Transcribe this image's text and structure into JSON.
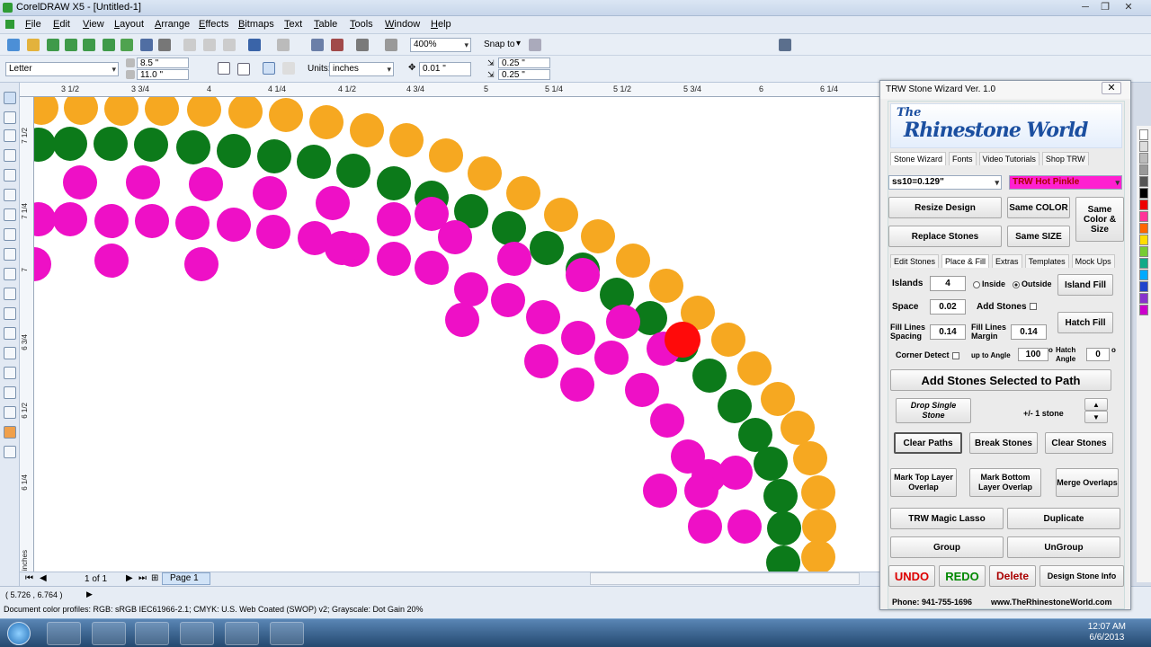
{
  "window": {
    "title": "CorelDRAW X5 - [Untitled-1]"
  },
  "menu": [
    "File",
    "Edit",
    "View",
    "Layout",
    "Arrange",
    "Effects",
    "Bitmaps",
    "Text",
    "Table",
    "Tools",
    "Window",
    "Help"
  ],
  "toolbar": {
    "zoom": "400%",
    "snap_to": "Snap to"
  },
  "property_bar": {
    "paper": "Letter",
    "width": "8.5 \"",
    "height": "11.0 \"",
    "units_label": "Units:",
    "units": "inches",
    "nudge": "0.01 \"",
    "dup_x": "0.25 \"",
    "dup_y": "0.25 \""
  },
  "ruler": {
    "h_ticks": [
      "3 1/2",
      "3 3/4",
      "4",
      "4 1/4",
      "4 1/2",
      "4 3/4",
      "5",
      "5 1/4",
      "5 1/2",
      "5 3/4",
      "6",
      "6 1/4"
    ],
    "v_ticks": [
      "7 1/2",
      "7 1/4",
      "7",
      "6 3/4",
      "6 1/2",
      "6 1/4"
    ],
    "unit": "inches"
  },
  "page_nav": {
    "count": "1 of 1",
    "tab": "Page 1"
  },
  "status": {
    "coords": "( 5.726 , 6.764 )",
    "profiles": "Document color profiles: RGB: sRGB IEC61966-2.1; CMYK: U.S. Web Coated (SWOP) v2; Grayscale: Dot Gain 20%"
  },
  "colors": {
    "orange": "#f6a821",
    "green": "#0c7a1a",
    "magenta": "#ee10c6",
    "red": "#ff0a0a",
    "hot_pink": "#ff20d0"
  },
  "wizard": {
    "title": "TRW Stone Wizard Ver. 1.0",
    "logo_top": "The",
    "logo": "Rhinestone World",
    "tabs": [
      "Stone Wizard",
      "Fonts",
      "Video Tutorials",
      "Shop TRW"
    ],
    "stone_size": "ss10=0.129\"",
    "color_name": "TRW Hot Pinkle",
    "buttons": {
      "resize": "Resize Design",
      "same_color": "Same COLOR",
      "same_color_size": "Same Color & Size",
      "replace": "Replace Stones",
      "same_size": "Same SIZE",
      "island_fill": "Island Fill",
      "hatch_fill": "Hatch Fill",
      "add_path": "Add Stones Selected to Path",
      "drop_single": "Drop Single Stone",
      "clear_paths": "Clear Paths",
      "break_stones": "Break Stones",
      "clear_stones": "Clear Stones",
      "mark_top": "Mark Top Layer Overlap",
      "mark_bottom": "Mark Bottom Layer Overlap",
      "merge": "Merge Overlaps",
      "lasso": "TRW Magic Lasso",
      "duplicate": "Duplicate",
      "group": "Group",
      "ungroup": "UnGroup",
      "undo": "UNDO",
      "redo": "REDO",
      "delete": "Delete",
      "design_info": "Design Stone Info"
    },
    "subtabs": [
      "Edit Stones",
      "Place & Fill",
      "Extras",
      "Templates",
      "Mock Ups"
    ],
    "fields": {
      "islands_label": "Islands",
      "islands": "4",
      "inside": "Inside",
      "outside": "Outside",
      "space_label": "Space",
      "space": "0.02",
      "add_stones": "Add Stones",
      "fill_spacing_label": "Fill Lines Spacing",
      "fill_spacing": "0.14",
      "fill_margin_label": "Fill Lines Margin",
      "fill_margin": "0.14",
      "corner_detect": "Corner Detect",
      "up_to_angle": "up to Angle",
      "angle": "100",
      "hatch_angle_label": "Hatch Angle",
      "hatch_angle": "0",
      "plus_minus": "+/- 1 stone",
      "degree": "o"
    },
    "footer": {
      "phone": "Phone: 941-755-1696",
      "site": "www.TheRhinestoneWorld.com"
    }
  },
  "clock": {
    "time": "12:07 AM",
    "date": "6/6/2013"
  }
}
